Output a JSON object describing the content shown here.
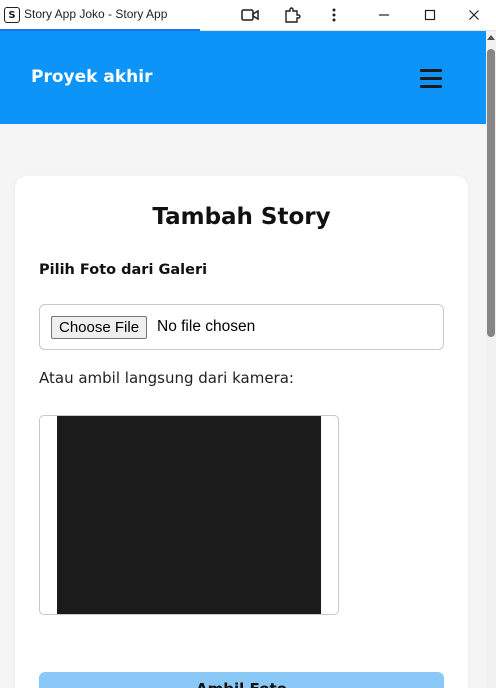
{
  "window": {
    "title": "Story App Joko - Story App",
    "app_icon_glyph": "S",
    "controls": [
      "camera-icon",
      "extension-icon",
      "more-icon",
      "minimize-icon",
      "maximize-icon",
      "close-icon"
    ]
  },
  "header": {
    "brand": "Proyek akhir",
    "menu_icon": "hamburger-icon",
    "background_color": "#0d94f8"
  },
  "form": {
    "title": "Tambah Story",
    "gallery_label": "Pilih Foto dari Galeri",
    "file_button_label": "Choose File",
    "file_status": "No file chosen",
    "camera_label": "Atau ambil langsung dari kamera:",
    "capture_button_label": "Ambil Foto",
    "capture_button_color": "#8ac8f8"
  }
}
